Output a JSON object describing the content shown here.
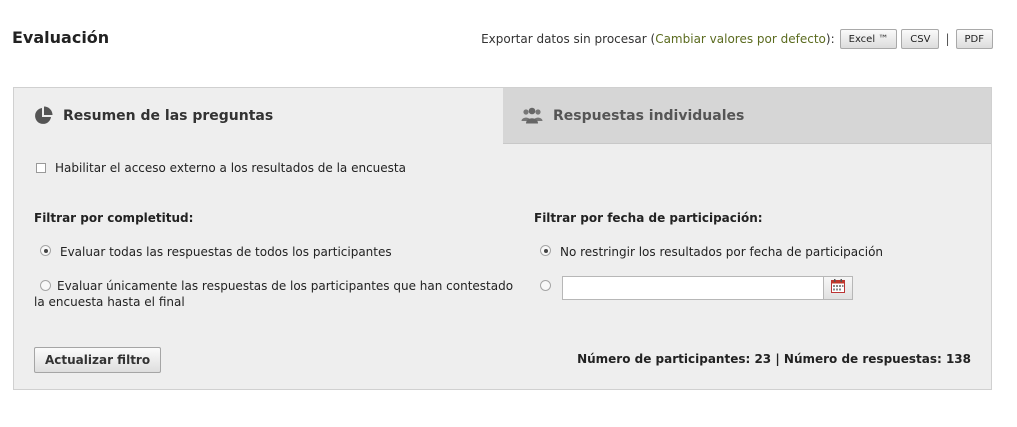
{
  "header": {
    "title": "Evaluación",
    "export_prefix": "Exportar datos sin procesar (",
    "export_link": "Cambiar valores por defecto",
    "export_suffix": "):",
    "buttons": {
      "excel": "Excel ™",
      "csv": "CSV",
      "separator": "|",
      "pdf": "PDF"
    }
  },
  "tabs": [
    {
      "label": "Resumen de las preguntas",
      "icon": "pie-chart-icon",
      "active": true
    },
    {
      "label": "Respuestas individuales",
      "icon": "users-icon",
      "active": false
    }
  ],
  "external_access": {
    "label": "Habilitar el acceso externo a los resultados de la encuesta",
    "checked": false
  },
  "filter_completeness": {
    "heading": "Filtrar por completitud:",
    "options": [
      {
        "label": "Evaluar todas las respuestas de todos los participantes",
        "selected": true
      },
      {
        "label": "Evaluar únicamente las respuestas de los participantes que han contestado la encuesta hasta el final",
        "selected": false
      }
    ]
  },
  "filter_date": {
    "heading": "Filtrar por fecha de participación:",
    "options": [
      {
        "label": "No restringir los resultados por fecha de participación",
        "selected": true
      },
      {
        "label": "",
        "selected": false
      }
    ],
    "date_value": "",
    "calendar_icon": "calendar-icon"
  },
  "update_button": "Actualizar filtro",
  "stats": "Número de participantes: 23 | Número de respuestas: 138",
  "colors": {
    "link": "#5b6b1f",
    "panel": "#eeeeee",
    "inactive_tab": "#d6d6d6"
  }
}
